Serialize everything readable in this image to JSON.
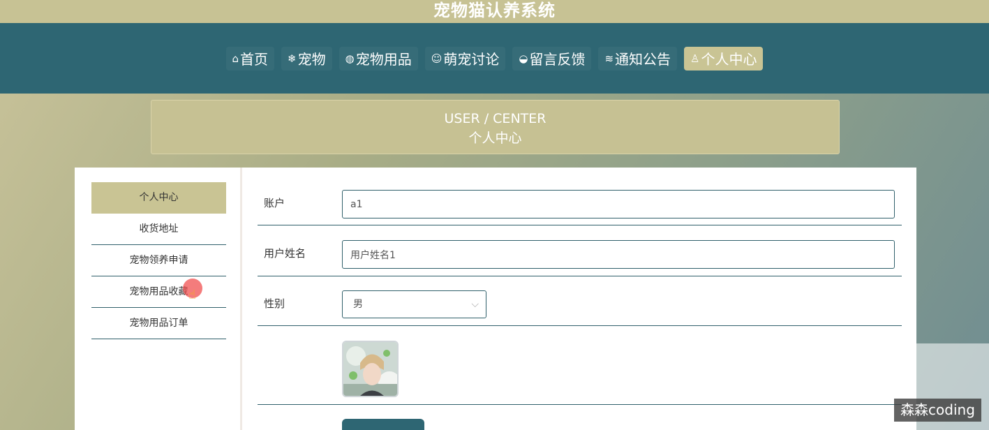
{
  "app": {
    "title": "宠物猫认养系统"
  },
  "nav": {
    "items": [
      {
        "icon": "home-icon",
        "glyph": "⌂",
        "label": "首页",
        "active": false
      },
      {
        "icon": "snowflake-icon",
        "glyph": "❄",
        "label": "宠物",
        "active": false
      },
      {
        "icon": "globe-icon",
        "glyph": "◍",
        "label": "宠物用品",
        "active": false
      },
      {
        "icon": "smile-icon",
        "glyph": "☺",
        "label": "萌宠讨论",
        "active": false
      },
      {
        "icon": "feedback-icon",
        "glyph": "◒",
        "label": "留言反馈",
        "active": false
      },
      {
        "icon": "layers-icon",
        "glyph": "≋",
        "label": "通知公告",
        "active": false
      },
      {
        "icon": "user-icon",
        "glyph": "♙",
        "label": "个人中心",
        "active": true
      }
    ]
  },
  "banner": {
    "en": "USER / CENTER",
    "cn": "个人中心"
  },
  "side_menu": {
    "items": [
      {
        "label": "个人中心",
        "active": true
      },
      {
        "label": "收货地址",
        "active": false
      },
      {
        "label": "宠物领养申请",
        "active": false
      },
      {
        "label": "宠物用品收藏",
        "active": false
      },
      {
        "label": "宠物用品订单",
        "active": false
      }
    ]
  },
  "form": {
    "account": {
      "label": "账户",
      "value": "a1"
    },
    "name": {
      "label": "用户姓名",
      "value": "用户姓名1"
    },
    "gender": {
      "label": "性别",
      "value": "男"
    }
  },
  "watermark": "森森coding",
  "colors": {
    "nav_bg": "#2e6673",
    "accent": "#c9c494",
    "title_bar": "#c7c294"
  }
}
